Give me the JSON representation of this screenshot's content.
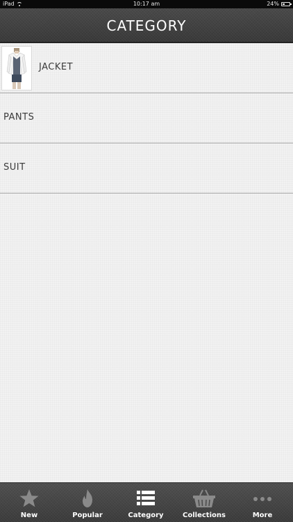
{
  "status_bar": {
    "device": "iPad",
    "time": "10:17 am",
    "battery": "24%"
  },
  "header": {
    "title": "CATEGORY"
  },
  "categories": [
    {
      "label": "JACKET",
      "has_thumbnail": true
    },
    {
      "label": "PANTS",
      "has_thumbnail": false
    },
    {
      "label": "SUIT",
      "has_thumbnail": false
    }
  ],
  "tabs": [
    {
      "label": "New",
      "icon": "star-icon",
      "selected": false
    },
    {
      "label": "Popular",
      "icon": "flame-icon",
      "selected": false
    },
    {
      "label": "Category",
      "icon": "list-icon",
      "selected": true
    },
    {
      "label": "Collections",
      "icon": "basket-icon",
      "selected": false
    },
    {
      "label": "More",
      "icon": "more-dots-icon",
      "selected": false
    }
  ],
  "colors": {
    "nav_bar": "#444444",
    "tab_bar": "#464646",
    "background": "#f2f2f2",
    "divider": "#a8a8a8",
    "inactive_icon": "#8a8a8a",
    "active_icon": "#ffffff"
  }
}
